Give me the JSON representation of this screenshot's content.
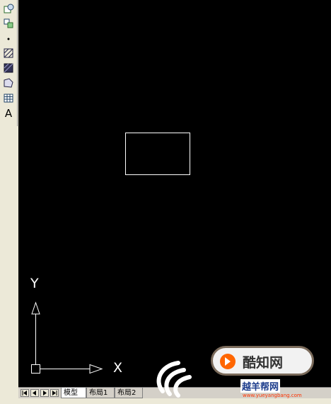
{
  "toolbar": {
    "tools": [
      {
        "name": "insert-block-icon"
      },
      {
        "name": "make-block-icon"
      },
      {
        "name": "point-icon"
      },
      {
        "name": "hatch-icon"
      },
      {
        "name": "gradient-icon"
      },
      {
        "name": "region-icon"
      },
      {
        "name": "table-icon"
      },
      {
        "name": "multiline-text-icon",
        "label": "A"
      }
    ]
  },
  "ucs": {
    "y_label": "Y",
    "x_label": "X"
  },
  "tabs": [
    {
      "label": "模型",
      "active": true
    },
    {
      "label": "布局1",
      "active": false
    },
    {
      "label": "布局2",
      "active": false
    }
  ],
  "watermark": {
    "brand": "酷知网",
    "site": "越羊帮网",
    "url": "www.yueyangbang.com"
  },
  "colors": {
    "canvas": "#000000",
    "line": "#ffffff",
    "toolbar": "#ece9d8"
  }
}
